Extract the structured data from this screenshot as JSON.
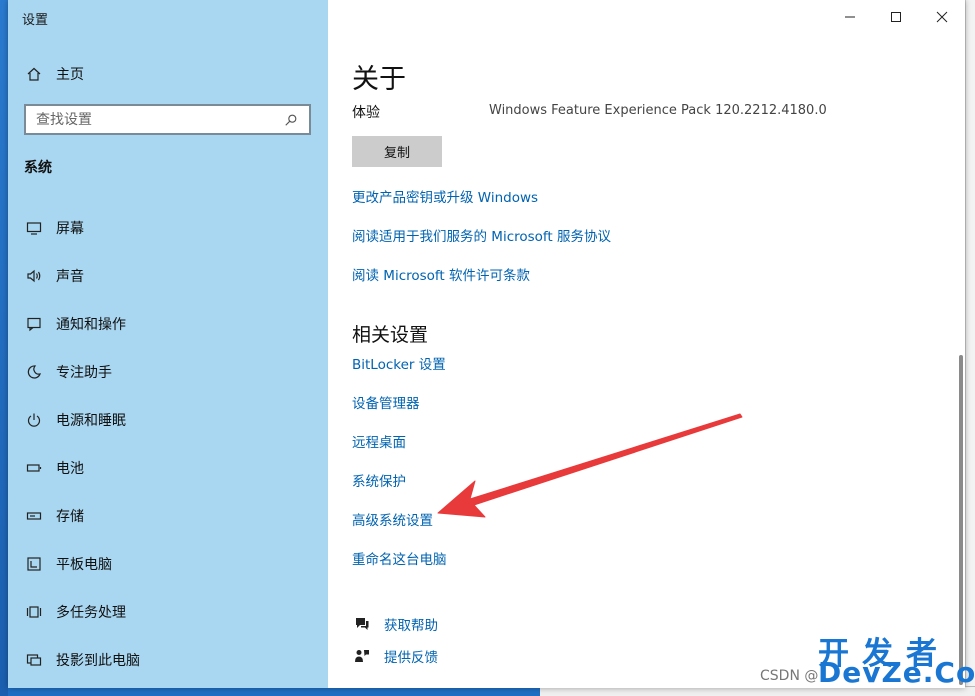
{
  "window": {
    "title": "设置",
    "controls": {
      "minimize": "minimize",
      "maximize": "maximize",
      "close": "close"
    }
  },
  "sidebar": {
    "home_label": "主页",
    "search_placeholder": "查找设置",
    "section": "系统",
    "items": [
      {
        "label": "屏幕",
        "icon": "monitor-icon"
      },
      {
        "label": "声音",
        "icon": "speaker-icon"
      },
      {
        "label": "通知和操作",
        "icon": "notification-icon"
      },
      {
        "label": "专注助手",
        "icon": "moon-icon"
      },
      {
        "label": "电源和睡眠",
        "icon": "power-icon"
      },
      {
        "label": "电池",
        "icon": "battery-icon"
      },
      {
        "label": "存储",
        "icon": "storage-icon"
      },
      {
        "label": "平板电脑",
        "icon": "tablet-icon"
      },
      {
        "label": "多任务处理",
        "icon": "multitask-icon"
      },
      {
        "label": "投影到此电脑",
        "icon": "project-icon"
      }
    ]
  },
  "main": {
    "title": "关于",
    "experience_key": "体验",
    "experience_value": "Windows Feature Experience Pack 120.2212.4180.0",
    "copy_label": "复制",
    "links": [
      "更改产品密钥或升级 Windows",
      "阅读适用于我们服务的 Microsoft 服务协议",
      "阅读 Microsoft 软件许可条款"
    ],
    "related_title": "相关设置",
    "related_links": [
      "BitLocker 设置",
      "设备管理器",
      "远程桌面",
      "系统保护",
      "高级系统设置",
      "重命名这台电脑"
    ],
    "help_label": "获取帮助",
    "feedback_label": "提供反馈"
  },
  "watermark": {
    "brand": "开发者",
    "domain": "DevZe.CoM",
    "csdn": "CSDN @"
  },
  "colors": {
    "sidebar_bg": "#a9d6f0",
    "link": "#0063b1",
    "arrow": "#e83a3a",
    "watermark": "#1976d2"
  }
}
